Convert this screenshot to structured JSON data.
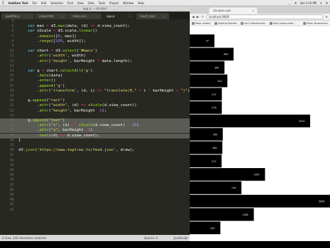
{
  "menubar": {
    "app": "Sublime Text",
    "items": [
      "File",
      "Edit",
      "Selection",
      "Find",
      "View",
      "Goto",
      "Tools",
      "Project",
      "Window",
      "Help"
    ],
    "clock": "Sat 2:19 PM"
  },
  "editor": {
    "window_title": "app.js — d3-start",
    "tabs": [
      {
        "label": "quadfile.js",
        "active": false
      },
      {
        "label": "index.html",
        "active": false
      },
      {
        "label": "main.scss",
        "active": false
      },
      {
        "label": "app.js",
        "active": true
      },
      {
        "label": "touch_task",
        "active": false
      }
    ],
    "lines": [
      {
        "n": "4",
        "html": ""
      },
      {
        "n": "5",
        "html": "    <span class='kw'>var</span> max <span class='op'>=</span> d3.<span class='fn'>max</span>(data, (d) <span class='op'>=&gt;</span> d.view_count);"
      },
      {
        "n": "6",
        "html": "    <span class='kw'>var</span> xScale <span class='op'>=</span> d3.scale.<span class='fn'>linear</span>()"
      },
      {
        "n": "7",
        "html": "        .<span class='fn'>domain</span>([<span class='num'>0</span>, max])"
      },
      {
        "n": "8",
        "html": "        .<span class='fn'>range</span>([<span class='num'>100</span>, width]);"
      },
      {
        "n": "9",
        "html": ""
      },
      {
        "n": "10",
        "html": "    <span class='kw'>var</span> chart <span class='op'>=</span> d3.<span class='fn'>select</span>(<span class='str'>'#main'</span>)"
      },
      {
        "n": "11",
        "html": "        .<span class='fn'>attr</span>(<span class='str'>'width'</span>, width)"
      },
      {
        "n": "12",
        "html": "        .<span class='fn'>attr</span>(<span class='str'>'height'</span>, barHeight <span class='op'>*</span> data.length);"
      },
      {
        "n": "13",
        "html": ""
      },
      {
        "n": "14",
        "html": "    <span class='kw'>var</span> g <span class='op'>=</span> chart.<span class='fn'>selectAll</span>(<span class='str'>'g'</span>)"
      },
      {
        "n": "15",
        "html": "        .<span class='fn'>data</span>(data)"
      },
      {
        "n": "16",
        "html": "        .<span class='fn'>enter</span>()"
      },
      {
        "n": "17",
        "html": "        .<span class='fn'>append</span>(<span class='str'>'g'</span>)"
      },
      {
        "n": "18",
        "html": "        .<span class='fn'>attr</span>(<span class='str'>'transform'</span>, (d, i) <span class='op'>=&gt;</span> <span class='str'>\"translate(0,\"</span> <span class='op'>+</span> i <span class='op'>*</span> barHeight <span class='op'>+</span> <span class='str'>\")\"</span>);"
      },
      {
        "n": "19",
        "html": ""
      },
      {
        "n": "20",
        "html": "    g.<span class='fn'>append</span>(<span class='str'>\"rect\"</span>)"
      },
      {
        "n": "21",
        "html": "        .<span class='fn'>attr</span>(<span class='str'>\"width\"</span>, (d) <span class='op'>=&gt;</span> <span class='fn'>xScale</span>(d.view_count))"
      },
      {
        "n": "22",
        "html": "        .<span class='fn'>attr</span>(<span class='str'>\"height\"</span>, barHeight <span class='op'>-</span><span class='num'>1</span>);"
      },
      {
        "n": "23",
        "html": ""
      },
      {
        "n": "24",
        "html": "    g.<span class='fn'>append</span>(<span class='str'>\"text\"</span>)",
        "sel": true
      },
      {
        "n": "25",
        "html": "        .<span class='fn'>attr</span>(<span class='str'>\"x\"</span>, (d) <span class='op'>=&gt;</span> <span class='fn'>xScale</span>(d.view_count) <span class='op'>-</span> <span class='num'>30</span>)",
        "sel": true
      },
      {
        "n": "26",
        "html": "        .<span class='fn'>attr</span>(<span class='str'>\"y\"</span>, barHeight <span class='op'>/</span><span class='num'>2</span>)",
        "sel": true
      },
      {
        "n": "27",
        "html": "        .<span class='fn'>text</span>((d) <span class='op'>=&gt;</span> d.view_count);",
        "sel": true
      },
      {
        "n": "28",
        "html": "}"
      },
      {
        "n": "29",
        "html": ""
      },
      {
        "n": "30",
        "html": "d3.<span class='fn'>json</span>(<span class='str'>'https://www.tagtree.tv/feed.json'</span>, draw);"
      },
      {
        "n": "31",
        "html": ""
      },
      {
        "n": "32",
        "html": ""
      },
      {
        "n": "33",
        "html": ""
      },
      {
        "n": "34",
        "html": ""
      },
      {
        "n": "35",
        "html": ""
      },
      {
        "n": "36",
        "html": ""
      },
      {
        "n": "37",
        "html": ""
      },
      {
        "n": "38",
        "html": ""
      },
      {
        "n": "39",
        "html": ""
      },
      {
        "n": "40",
        "html": ""
      },
      {
        "n": "41",
        "html": ""
      },
      {
        "n": "42",
        "html": ""
      }
    ],
    "status_left": "4 lines, 140 characters selected",
    "status_spaces": "Spaces: 4",
    "status_syntax": "JavaScript"
  },
  "browser": {
    "tab_title": "d3-start.com",
    "url": "localhost:8000",
    "bookmarks": [
      "Most visited",
      "Getting Started",
      "ALL's Bookmarks",
      "http://www.vistit..."
    ],
    "bookmarks_right": "Other Bookmarks"
  },
  "chart_data": {
    "type": "bar",
    "orientation": "horizontal",
    "values": [
      97,
      560,
      340,
      410,
      277,
      276,
      2410,
      300,
      289,
      272,
      1320,
      750,
      2890,
      1050,
      241
    ],
    "labels": [
      "97",
      "560",
      "340",
      "410",
      "277",
      "276",
      "2410",
      "300",
      "289",
      "272",
      "1320",
      "750",
      "2890",
      "1050",
      "241"
    ],
    "bar_color": "#000000",
    "label_color": "#ffffff",
    "xlim": [
      0,
      2890
    ]
  }
}
